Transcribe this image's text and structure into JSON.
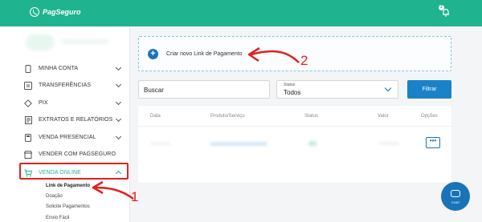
{
  "header": {
    "logo_text": "PagSeguro",
    "notification_count": "2"
  },
  "sidebar": {
    "items": [
      {
        "label": "MINHA CONTA",
        "icon": "phone-icon"
      },
      {
        "label": "TRANSFERÊNCIAS",
        "icon": "transfer-icon"
      },
      {
        "label": "PIX",
        "icon": "pix-icon"
      },
      {
        "label": "EXTRATOS E RELATÓRIOS",
        "icon": "receipt-icon"
      },
      {
        "label": "VENDA PRESENCIAL",
        "icon": "pos-icon"
      },
      {
        "label": "VENDER COM PAGSEGURO",
        "icon": "store-icon"
      },
      {
        "label": "VENDA ONLINE",
        "icon": "cart-icon"
      }
    ],
    "subitems": [
      "Link de Pagamento",
      "Doação",
      "Solicite Pagamentos",
      "Envio Fácil"
    ]
  },
  "main": {
    "create_label": "Criar novo Link de Pagamento",
    "search_value": "Buscar",
    "status_caption": "Status",
    "status_value": "Todos",
    "filter_label": "Filtrar",
    "columns": [
      "Data",
      "Produto/Serviço",
      "Status",
      "Valor",
      "Opções"
    ],
    "options_glyph": "•••"
  },
  "chat": {
    "label": "CHAT"
  },
  "annotations": {
    "one": "1",
    "two": "2"
  },
  "colors": {
    "brand": "#20b38f",
    "accent": "#1a73b8",
    "annotation": "#e02020"
  }
}
